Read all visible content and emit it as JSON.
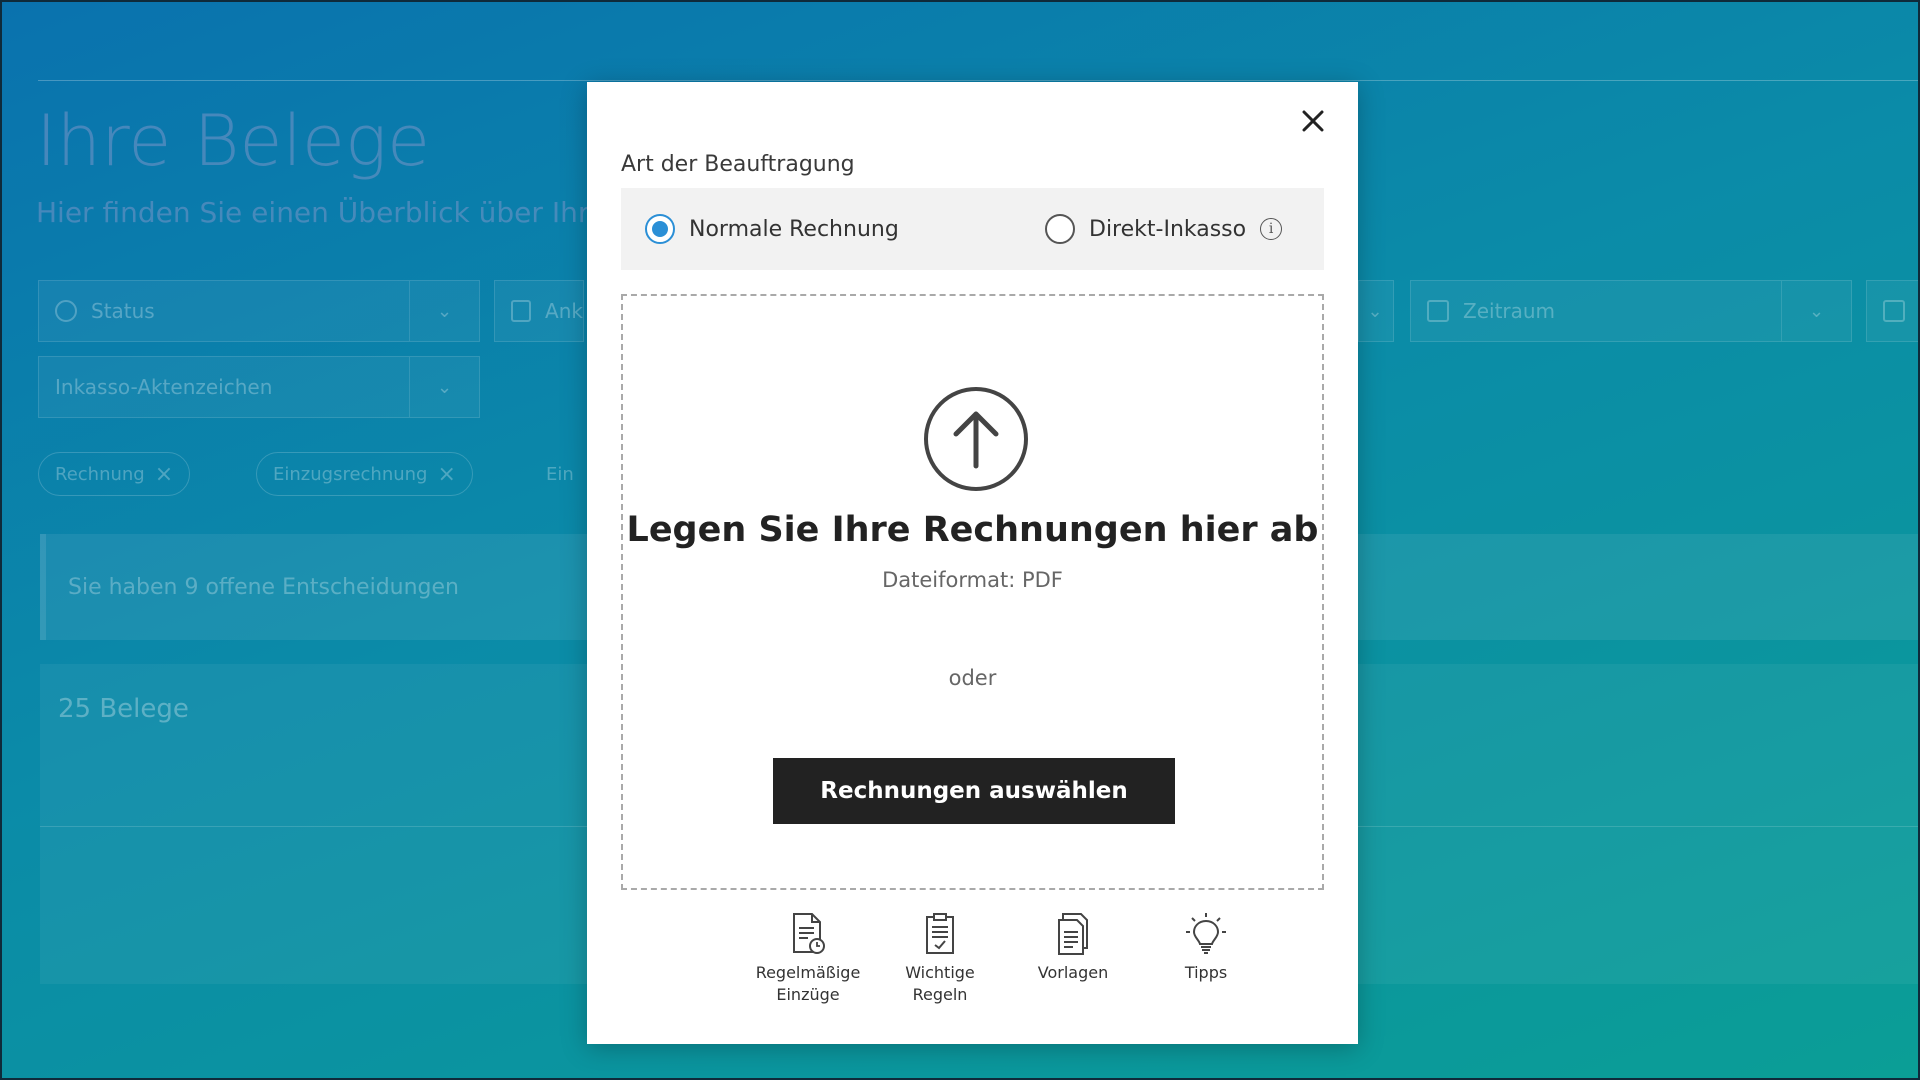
{
  "background": {
    "page_title": "Ihre Belege",
    "page_subtitle": "Hier finden Sie einen Überblick über Ihre",
    "filters": {
      "status": "Status",
      "ank": "Ank",
      "zeitraum": "Zeitraum",
      "aktenzeichen": "Inkasso-Aktenzeichen"
    },
    "chips": [
      "Rechnung",
      "Einzugsrechnung",
      "Ein"
    ],
    "banner": "Sie haben 9 offene Entscheidungen",
    "count": "25 Belege"
  },
  "modal": {
    "close_icon": "close-icon",
    "section_label": "Art der Beauftragung",
    "options": [
      {
        "label": "Normale Rechnung",
        "checked": true
      },
      {
        "label": "Direkt-Inkasso",
        "checked": false,
        "info": "i"
      }
    ],
    "dropzone": {
      "title": "Legen Sie Ihre Rechnungen hier ab",
      "format": "Dateiformat: PDF",
      "or": "oder",
      "button_label": "Rechnungen auswählen"
    },
    "tools": [
      {
        "label_line1": "Regelmäßige",
        "label_line2": "Einzüge",
        "icon": "recurring-document-icon"
      },
      {
        "label_line1": "Wichtige",
        "label_line2": "Regeln",
        "icon": "clipboard-check-icon"
      },
      {
        "label_line1": "Vorlagen",
        "label_line2": "",
        "icon": "document-icon"
      },
      {
        "label_line1": "Tipps",
        "label_line2": "",
        "icon": "lightbulb-icon"
      }
    ]
  },
  "colors": {
    "accent": "#2b8fd6",
    "button_bg": "#222222",
    "overlay_start": "#0a72ae",
    "overlay_end": "#0b9e96"
  }
}
